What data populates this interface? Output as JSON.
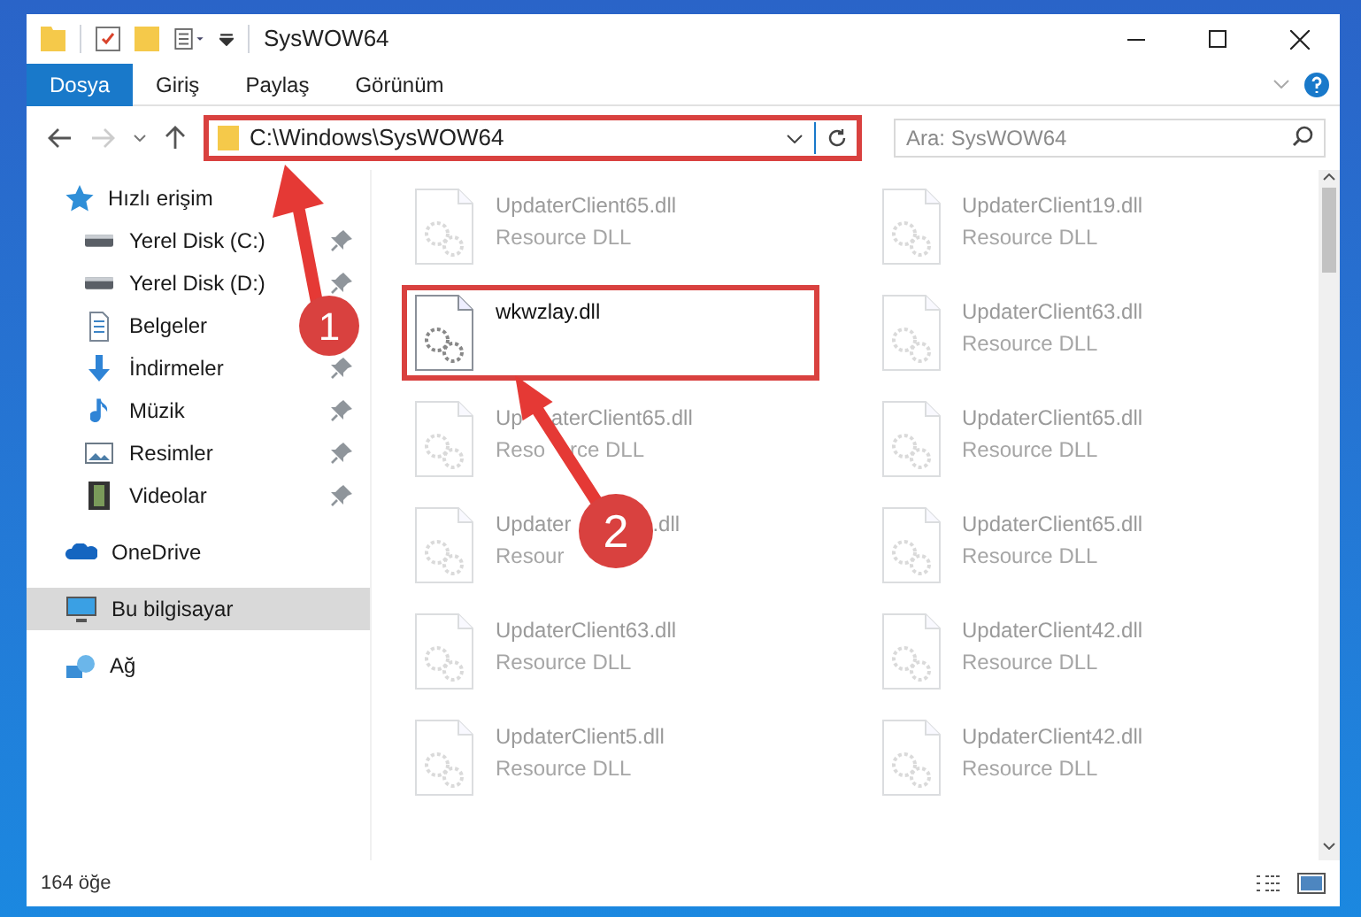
{
  "window": {
    "title": "SysWOW64"
  },
  "ribbon_tabs": [
    {
      "label": "Dosya",
      "selected": true
    },
    {
      "label": "Giriş",
      "selected": false
    },
    {
      "label": "Paylaş",
      "selected": false
    },
    {
      "label": "Görünüm",
      "selected": false
    }
  ],
  "address_bar": {
    "path": "C:\\Windows\\SysWOW64",
    "highlighted": true
  },
  "search": {
    "placeholder": "Ara: SysWOW64"
  },
  "sidebar": {
    "items": [
      {
        "label": "Hızlı erişim",
        "kind": "star",
        "selected": false,
        "children": [
          {
            "label": "Yerel Disk (C:)",
            "kind": "drive",
            "pinned": true,
            "selected": false
          },
          {
            "label": "Yerel Disk (D:)",
            "kind": "drive",
            "pinned": true,
            "selected": false
          },
          {
            "label": "Belgeler",
            "kind": "document",
            "selected": false
          },
          {
            "label": "İndirmeler",
            "kind": "download",
            "pinned": true,
            "selected": false
          },
          {
            "label": "Müzik",
            "kind": "music",
            "pinned": true,
            "selected": false
          },
          {
            "label": "Resimler",
            "kind": "image",
            "pinned": true,
            "selected": false
          },
          {
            "label": "Videolar",
            "kind": "video",
            "pinned": true,
            "selected": false
          }
        ]
      },
      {
        "label": "OneDrive",
        "kind": "cloud",
        "selected": false
      },
      {
        "label": "Bu bilgisayar",
        "kind": "computer",
        "selected": true
      },
      {
        "label": "Ağ",
        "kind": "network",
        "selected": false
      }
    ]
  },
  "files": [
    {
      "name": "UpdaterClient65.dll",
      "type": "Resource DLL",
      "faded": true,
      "highlighted": false
    },
    {
      "name": "UpdaterClient19.dll",
      "type": "Resource DLL",
      "faded": true,
      "highlighted": false
    },
    {
      "name": "wkwzlay.dll",
      "faded": false,
      "highlighted": true
    },
    {
      "name": "UpdaterClient63.dll",
      "type": "Resource DLL",
      "faded": true,
      "highlighted": false
    },
    {
      "name_parts": [
        "Up",
        "aterClient65.dll"
      ],
      "type_parts": [
        "Reso",
        "rce DLL"
      ],
      "faded": true,
      "highlighted": false
    },
    {
      "name": "UpdaterClient65.dll",
      "type": "Resource DLL",
      "faded": true,
      "highlighted": false
    },
    {
      "name_parts": [
        "Updater",
        ".dll"
      ],
      "type_parts": [
        "Resour"
      ],
      "faded": true,
      "highlighted": false
    },
    {
      "name": "UpdaterClient65.dll",
      "type": "Resource DLL",
      "faded": true,
      "highlighted": false
    },
    {
      "name": "UpdaterClient63.dll",
      "type": "Resource DLL",
      "faded": true,
      "highlighted": false
    },
    {
      "name": "UpdaterClient42.dll",
      "type": "Resource DLL",
      "faded": true,
      "highlighted": false
    },
    {
      "name": "UpdaterClient5.dll",
      "type": "Resource DLL",
      "faded": true,
      "highlighted": false
    },
    {
      "name": "UpdaterClient42.dll",
      "type": "Resource DLL",
      "faded": true,
      "highlighted": false
    }
  ],
  "status_bar": {
    "count": "164 öğe"
  },
  "annotations": [
    {
      "number": "1"
    },
    {
      "number": "2"
    }
  ]
}
